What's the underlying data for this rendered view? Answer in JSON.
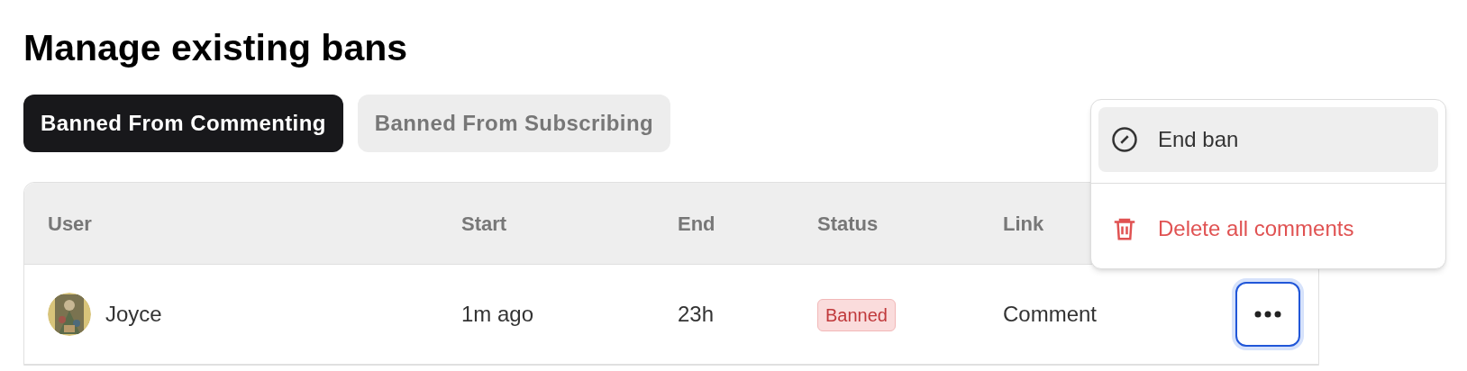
{
  "title": "Manage existing bans",
  "tabs": [
    {
      "label": "Banned From Commenting",
      "selected": true
    },
    {
      "label": "Banned From Subscribing",
      "selected": false
    }
  ],
  "table": {
    "columns": [
      "User",
      "Start",
      "End",
      "Status",
      "Link"
    ],
    "rows": [
      {
        "user": "Joyce",
        "start": "1m ago",
        "end": "23h",
        "status": "Banned",
        "link": "Comment",
        "menu_open": true
      }
    ]
  },
  "menu": {
    "items": [
      {
        "label": "End ban",
        "kind": "end",
        "highlighted": true
      },
      {
        "label": "Delete all comments",
        "kind": "delete",
        "highlighted": false
      }
    ]
  }
}
